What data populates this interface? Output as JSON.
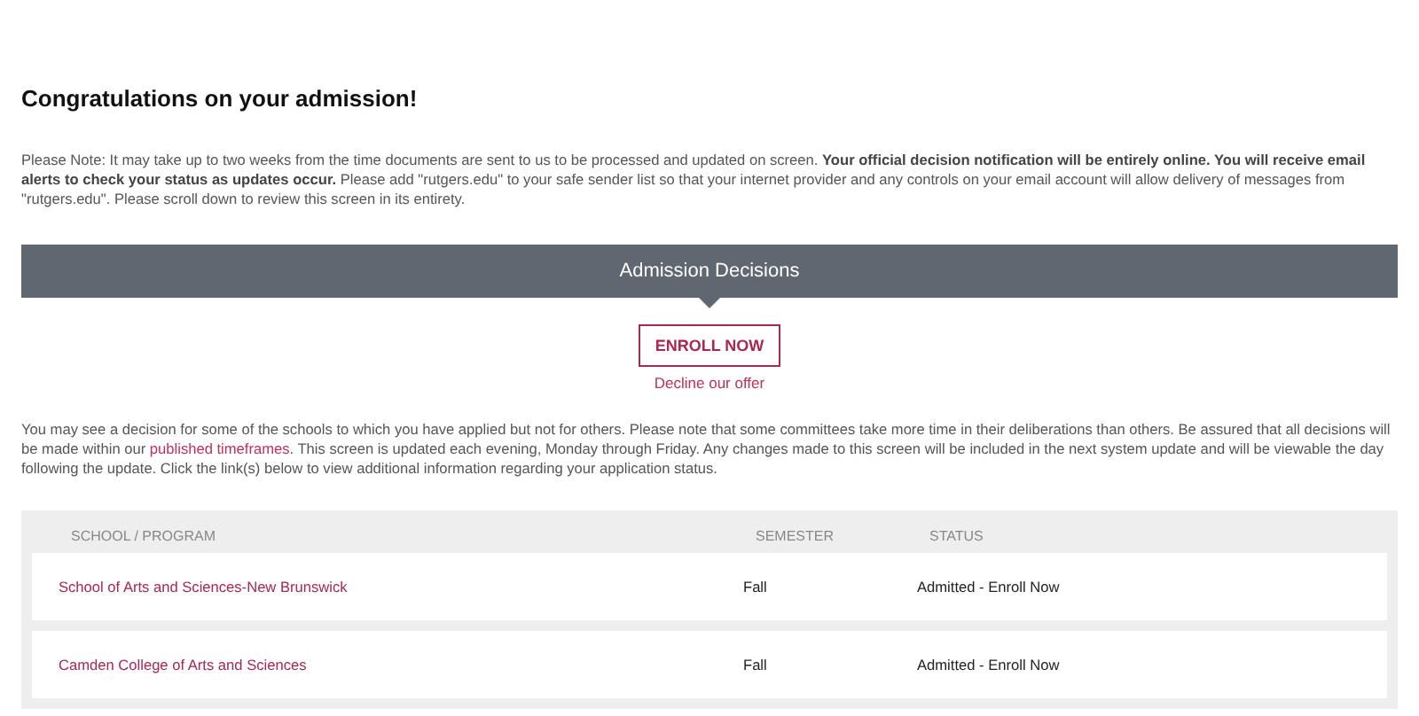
{
  "title": "Congratulations on your admission!",
  "note": "Please Note: It may take up to two weeks from the time documents are sent to us to be processed and updated on screen. **Your official decision notification will be entirely online. You will receive email alerts to check your status as updates occur.** Please add \"rutgers.edu\" to your safe sender list so that your internet provider and any controls on your email account will allow delivery of messages from \"rutgers.edu\". Please scroll down to review this screen in its entirety.",
  "banner": "Admission Decisions",
  "enroll_button": "ENROLL NOW",
  "decline_link": "Decline our offer",
  "info": {
    "before": "You may see a decision for some of the schools to which you have applied but not for others. Please note that some committees take more time in their deliberations than others. Be assured that all decisions will be made within our",
    "link": "published timeframes",
    "after": ". This screen is updated each evening, Monday through Friday. Any changes made to this screen will be included in the next system update and will be viewable the day following the update. Click the link(s) below to view additional information regarding your application status."
  },
  "table": {
    "columns": [
      "SCHOOL / PROGRAM",
      "SEMESTER",
      "STATUS"
    ],
    "rows": [
      {
        "school": "School of Arts and Sciences-New Brunswick",
        "semester": "Fall",
        "status": "Admitted - Enroll Now"
      },
      {
        "school": "Camden College of Arts and Sciences",
        "semester": "Fall",
        "status": "Admitted - Enroll Now"
      }
    ]
  }
}
